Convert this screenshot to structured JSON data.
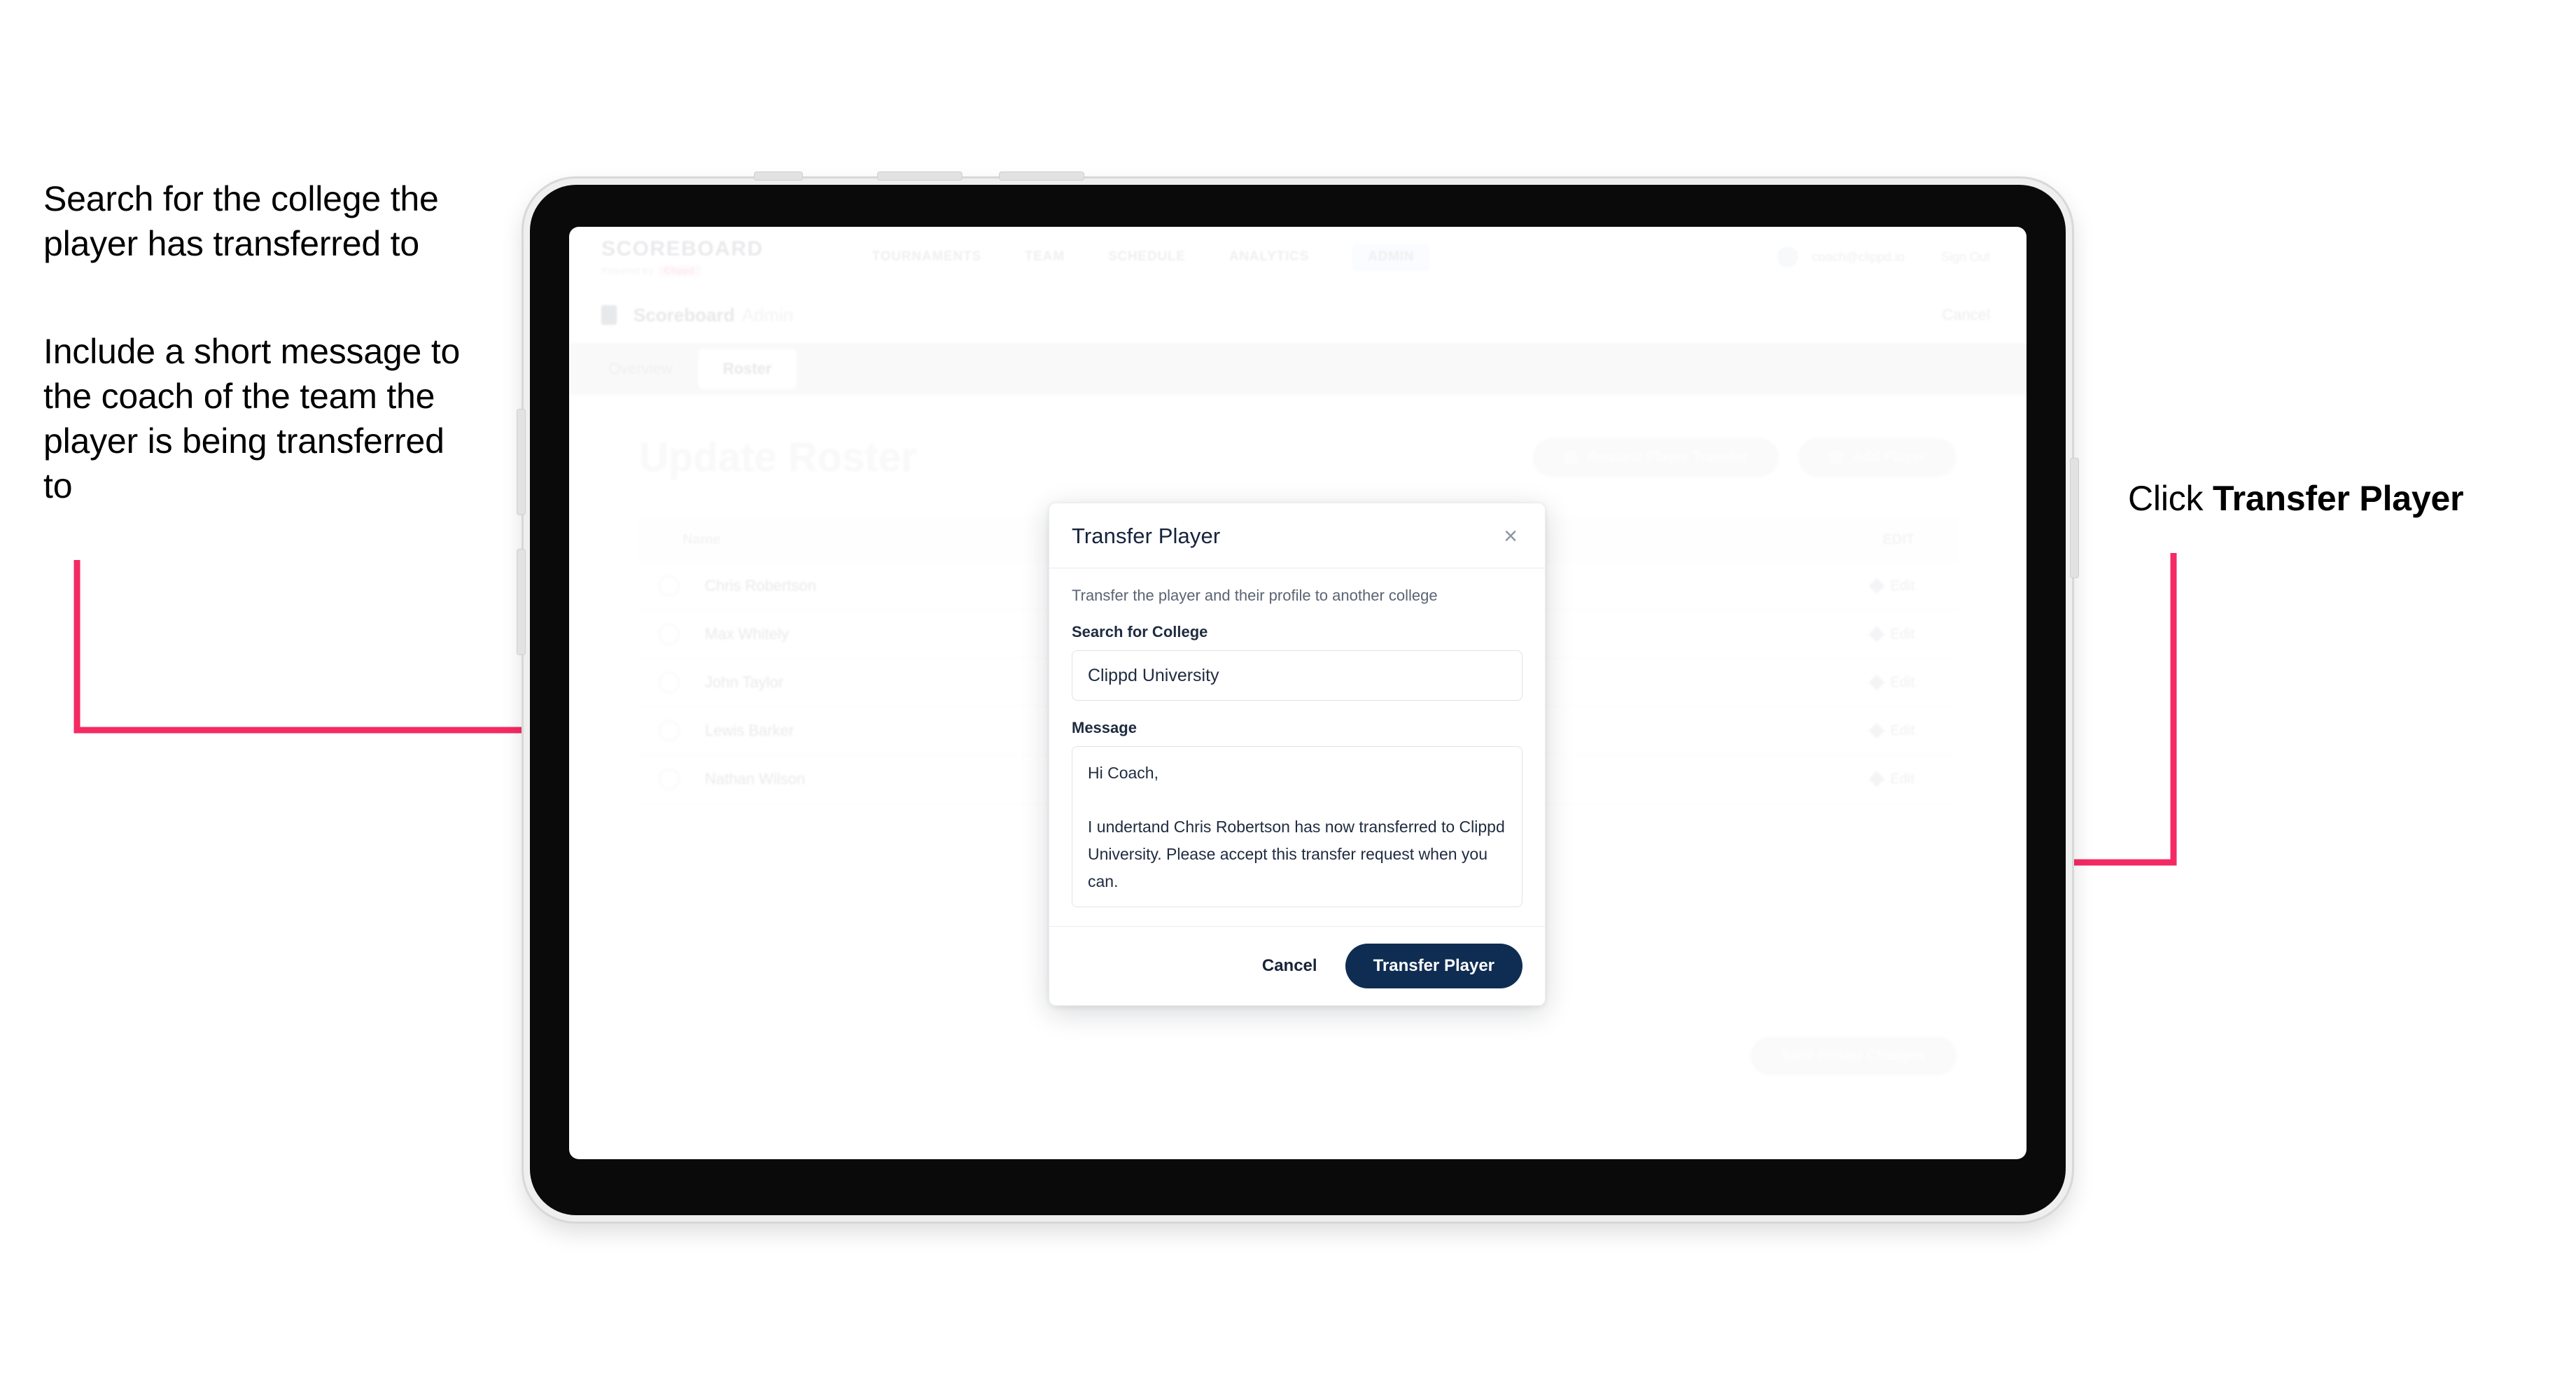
{
  "annotations": {
    "left_1": "Search for the college the player has transferred to",
    "left_2": "Include a short message to the coach of the team the player is being transferred to",
    "right_prefix": "Click ",
    "right_bold": "Transfer Player"
  },
  "colors": {
    "arrow": "#F42A63",
    "primary_button": "#0F2D52",
    "brand_accent": "#E8356D",
    "nav_badge": "#CDDCFB"
  },
  "app": {
    "brand": {
      "title": "SCOREBOARD",
      "sub_prefix": "Powered by",
      "sub_pill": "Clippd"
    },
    "nav": [
      "TOURNAMENTS",
      "TEAM",
      "SCHEDULE",
      "ANALYTICS"
    ],
    "nav_badge": "ADMIN",
    "user": {
      "email": "coach@clippd.io",
      "sign_out": "Sign Out"
    },
    "breadcrumb": {
      "label": "Scoreboard",
      "suffix": "Admin",
      "cancel": "Cancel"
    },
    "tabs": [
      {
        "label": "Overview",
        "active": false
      },
      {
        "label": "Roster",
        "active": true
      }
    ],
    "page_title": "Update Roster",
    "top_actions": [
      "Request Player Transfer",
      "Add Player"
    ],
    "bottom_action": "Save Roster Changes",
    "table": {
      "columns": {
        "name": "Name",
        "action": "EDIT"
      },
      "rows": [
        {
          "name": "Chris Robertson",
          "action": "Edit"
        },
        {
          "name": "Max Whitely",
          "action": "Edit"
        },
        {
          "name": "John Taylor",
          "action": "Edit"
        },
        {
          "name": "Lewis Barker",
          "action": "Edit"
        },
        {
          "name": "Nathan Wilson",
          "action": "Edit"
        }
      ]
    }
  },
  "modal": {
    "title": "Transfer Player",
    "close_label": "×",
    "description": "Transfer the player and their profile to another college",
    "college_label": "Search for College",
    "college_value": "Clippd University",
    "college_placeholder": "Search for College",
    "message_label": "Message",
    "message_value": "Hi Coach,\n\nI undertand Chris Robertson has now transferred to Clippd University. Please accept this transfer request when you can.",
    "message_placeholder": "Message",
    "cancel_label": "Cancel",
    "submit_label": "Transfer Player"
  }
}
